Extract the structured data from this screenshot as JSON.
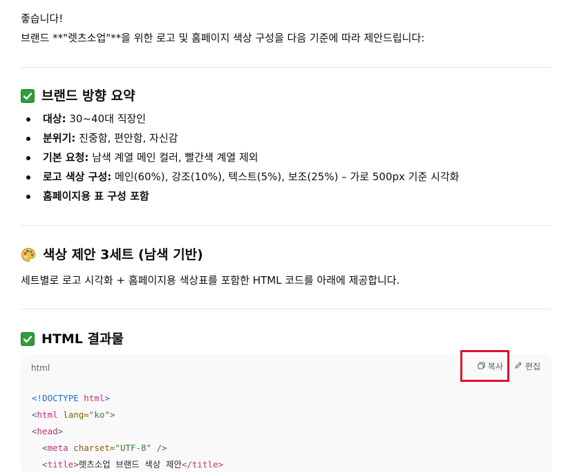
{
  "intro": {
    "line1": "좋습니다!",
    "line2": "브랜드 **\"렛츠소업\"**을 위한 로고 및 홈페이지 색상 구성을 다음 기준에 따라 제안드립니다:"
  },
  "summary": {
    "heading": "브랜드 방향 요약",
    "items": [
      {
        "label": "대상:",
        "text": " 30~40대 직장인"
      },
      {
        "label": "분위기:",
        "text": " 진중함, 편안함, 자신감"
      },
      {
        "label": "기본 요청:",
        "text": " 남색 계열 메인 컬러, 빨간색 계열 제외"
      },
      {
        "label": "로고 색상 구성:",
        "text": " 메인(60%), 강조(10%), 텍스트(5%), 보조(25%) – 가로 500px 기준 시각화"
      },
      {
        "label": "홈페이지용 표 구성 포함",
        "text": ""
      }
    ]
  },
  "proposal": {
    "heading": "색상 제안 3세트 (남색 기반)",
    "desc": "세트별로 로고 시각화 + 홈페이지용 색상표를 포함한 HTML 코드를 아래에 제공합니다."
  },
  "result": {
    "heading": "HTML 결과물"
  },
  "code_block": {
    "language": "html",
    "copy_label": "복사",
    "edit_label": "편집",
    "lines": [
      {
        "open": "<!",
        "tag": "DOCTYPE",
        "attr": " html",
        "val": "",
        "close": ">"
      },
      {
        "open": "<",
        "tag": "html",
        "attr": " lang=",
        "val": "\"ko\"",
        "close": ">"
      },
      {
        "open": "<",
        "tag": "head",
        "attr": "",
        "val": "",
        "close": ">"
      },
      {
        "open": "  <",
        "tag": "meta",
        "attr": " charset=",
        "val": "\"UTF-8\"",
        "close": " />"
      },
      {
        "open": "  <",
        "tag": "title",
        "attr": "",
        "val": "",
        "close": ">",
        "text": "렛츠소업 브랜드 색상 제안",
        "end": "</title>"
      }
    ]
  },
  "colors": {
    "check_green": "#2e9e3e",
    "highlight_red": "#e0102a",
    "code_bg": "#f9f9f9"
  }
}
